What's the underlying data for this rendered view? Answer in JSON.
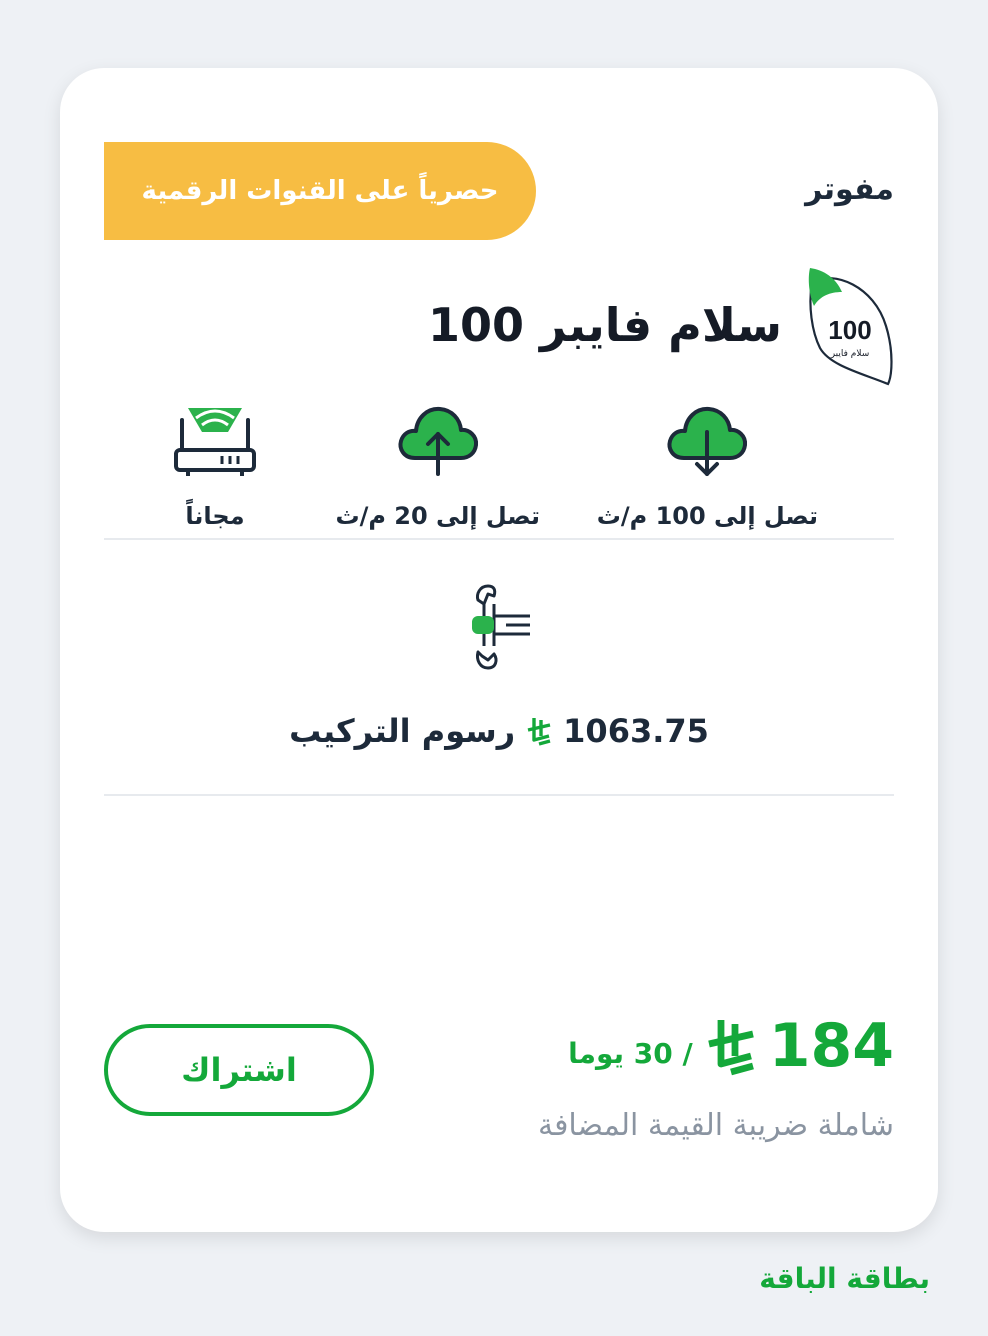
{
  "card": {
    "billing_type": "مفوتر",
    "promo_banner": "حصرياً على القنوات الرقمية",
    "plan_name": "سلام فايبر 100",
    "plan_logo": {
      "number": "100",
      "caption": "سلام فايبر"
    },
    "features": [
      {
        "icon": "cloud-download-icon",
        "label": "تصل إلى 100 م/ث"
      },
      {
        "icon": "cloud-upload-icon",
        "label": "تصل إلى 20 م/ث"
      },
      {
        "icon": "wifi-router-icon",
        "label": "مجاناً"
      }
    ],
    "installation": {
      "amount": "1063.75",
      "label": "رسوم التركيب",
      "icon": "wrench-hand-icon"
    },
    "price": {
      "amount": "184",
      "period": "/ 30 يوما",
      "vat_note": "شاملة ضريبة القيمة المضافة"
    },
    "subscribe_label": "اشتراك"
  },
  "footer_link": "بطاقة الباقة",
  "colors": {
    "accent_green": "#14a83a",
    "banner_yellow": "#f7bd43",
    "text_dark": "#1d2a3a",
    "text_muted": "#8a94a1"
  }
}
